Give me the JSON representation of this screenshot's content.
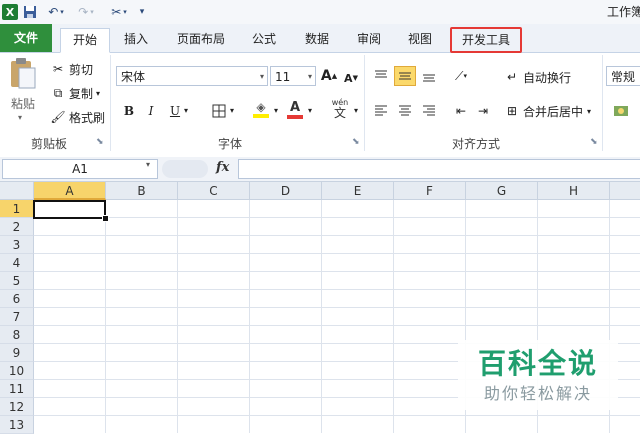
{
  "app": {
    "title": "工作簿"
  },
  "tabs": [
    {
      "label": "文件"
    },
    {
      "label": "开始"
    },
    {
      "label": "插入"
    },
    {
      "label": "页面布局"
    },
    {
      "label": "公式"
    },
    {
      "label": "数据"
    },
    {
      "label": "审阅"
    },
    {
      "label": "视图"
    },
    {
      "label": "开发工具"
    }
  ],
  "ribbon": {
    "clipboard": {
      "group_label": "剪贴板",
      "paste": "粘贴",
      "cut": "剪切",
      "copy": "复制",
      "format_painter": "格式刷"
    },
    "font": {
      "group_label": "字体",
      "font_name": "宋体",
      "font_size": "11",
      "grow_label": "A",
      "shrink_label": "A",
      "bold": "B",
      "italic": "I",
      "underline": "U",
      "font_color_label": "A",
      "phonetic_label": "wén"
    },
    "alignment": {
      "group_label": "对齐方式",
      "wrap_text": "自动换行",
      "merge_center": "合并后居中"
    },
    "number": {
      "format": "常规"
    }
  },
  "formula_bar": {
    "name_box": "A1",
    "fx_label": "fx",
    "value": ""
  },
  "grid": {
    "columns": [
      "A",
      "B",
      "C",
      "D",
      "E",
      "F",
      "G",
      "H"
    ],
    "rows": [
      "1",
      "2",
      "3",
      "4",
      "5",
      "6",
      "7",
      "8",
      "9",
      "10",
      "11",
      "12",
      "13"
    ],
    "active_cell": "A1"
  },
  "watermark": {
    "title": "百科全说",
    "subtitle": "助你轻松解决"
  },
  "colors": {
    "file_tab": "#2f8f3c",
    "highlight_box": "#e53935",
    "selected_header": "#f7d46b",
    "watermark": "#1f9e6e"
  }
}
